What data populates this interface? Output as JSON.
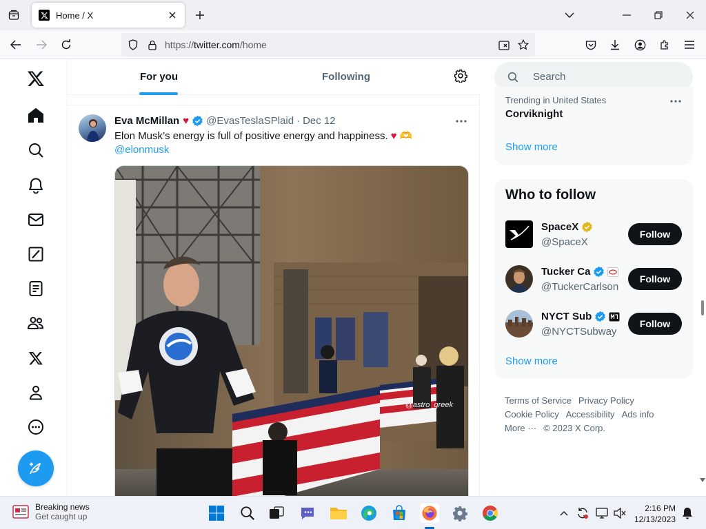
{
  "browser": {
    "tab_title": "Home / X",
    "url_prefix": "https://",
    "url_host": "twitter.com",
    "url_path": "/home"
  },
  "leftnav": {
    "icons": [
      "x-logo-icon",
      "home-icon",
      "explore-icon",
      "notifications-icon",
      "messages-icon",
      "grok-icon",
      "lists-icon",
      "communities-icon",
      "premium-icon",
      "profile-icon",
      "more-icon"
    ],
    "compose_icon": "compose-post-icon"
  },
  "feed": {
    "tabs": [
      "For you",
      "Following"
    ],
    "active_tab": "For you",
    "accent": "#1d9bf0"
  },
  "tweet": {
    "author_name": "Eva McMillan",
    "heart": "♥",
    "handle": "@EvasTeslaSPlaid",
    "separator": "·",
    "date": "Dec 12",
    "text": "Elon Musk’s energy is full of positive energy and happiness.",
    "text_emoji": "♥ 🫶",
    "mention": "@elonmusk",
    "media_watermark": "@astro_greek"
  },
  "sidebar": {
    "search_placeholder": "Search",
    "trend": {
      "context": "Trending in United States",
      "name": "Corviknight",
      "show_more": "Show more"
    },
    "who_to_follow": {
      "title": "Who to follow",
      "accounts": [
        {
          "name": "SpaceX",
          "handle": "@SpaceX",
          "verified": "gold",
          "button": "Follow"
        },
        {
          "name": "Tucker Ca",
          "handle": "@TuckerCarlson",
          "verified": "blue",
          "button": "Follow"
        },
        {
          "name": "NYCT Sub",
          "handle": "@NYCTSubway",
          "verified": "blue",
          "button": "Follow"
        }
      ],
      "show_more": "Show more"
    },
    "footer": {
      "links": [
        "Terms of Service",
        "Privacy Policy",
        "Cookie Policy",
        "Accessibility",
        "Ads info",
        "More ···"
      ],
      "copyright": "© 2023 X Corp."
    }
  },
  "taskbar": {
    "news_title": "Breaking news",
    "news_sub": "Get caught up",
    "time": "2:16 PM",
    "date": "12/13/2023"
  }
}
